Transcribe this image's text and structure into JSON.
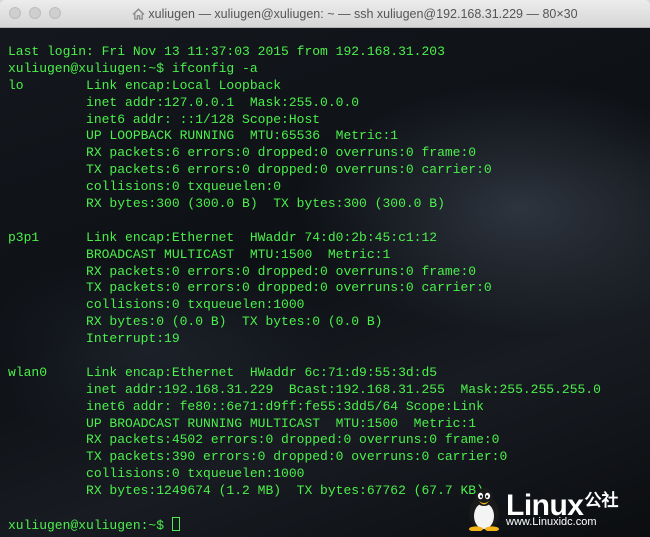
{
  "window": {
    "title": "xuliugen — xuliugen@xuliugen: ~ — ssh xuliugen@192.168.31.229 — 80×30",
    "icon": "home-icon"
  },
  "terminal": {
    "text_color": "#4bf04b",
    "last_login": "Last login: Fri Nov 13 11:37:03 2015 from 192.168.31.203",
    "command_line": "xuliugen@xuliugen:~$ ifconfig -a",
    "interfaces": [
      {
        "name": "lo",
        "lines": [
          "lo        Link encap:Local Loopback",
          "          inet addr:127.0.0.1  Mask:255.0.0.0",
          "          inet6 addr: ::1/128 Scope:Host",
          "          UP LOOPBACK RUNNING  MTU:65536  Metric:1",
          "          RX packets:6 errors:0 dropped:0 overruns:0 frame:0",
          "          TX packets:6 errors:0 dropped:0 overruns:0 carrier:0",
          "          collisions:0 txqueuelen:0",
          "          RX bytes:300 (300.0 B)  TX bytes:300 (300.0 B)"
        ]
      },
      {
        "name": "p3p1",
        "lines": [
          "p3p1      Link encap:Ethernet  HWaddr 74:d0:2b:45:c1:12",
          "          BROADCAST MULTICAST  MTU:1500  Metric:1",
          "          RX packets:0 errors:0 dropped:0 overruns:0 frame:0",
          "          TX packets:0 errors:0 dropped:0 overruns:0 carrier:0",
          "          collisions:0 txqueuelen:1000",
          "          RX bytes:0 (0.0 B)  TX bytes:0 (0.0 B)",
          "          Interrupt:19"
        ]
      },
      {
        "name": "wlan0",
        "lines": [
          "wlan0     Link encap:Ethernet  HWaddr 6c:71:d9:55:3d:d5",
          "          inet addr:192.168.31.229  Bcast:192.168.31.255  Mask:255.255.255.0",
          "          inet6 addr: fe80::6e71:d9ff:fe55:3dd5/64 Scope:Link",
          "          UP BROADCAST RUNNING MULTICAST  MTU:1500  Metric:1",
          "          RX packets:4502 errors:0 dropped:0 overruns:0 frame:0",
          "          TX packets:390 errors:0 dropped:0 overruns:0 carrier:0",
          "          collisions:0 txqueuelen:1000",
          "          RX bytes:1249674 (1.2 MB)  TX bytes:67762 (67.7 KB)"
        ]
      }
    ],
    "prompt": "xuliugen@xuliugen:~$ "
  },
  "watermark": {
    "brand": "Linux",
    "brand_cn": "公社",
    "url": "www.Linuxidc.com",
    "icon": "tux-penguin-icon"
  }
}
